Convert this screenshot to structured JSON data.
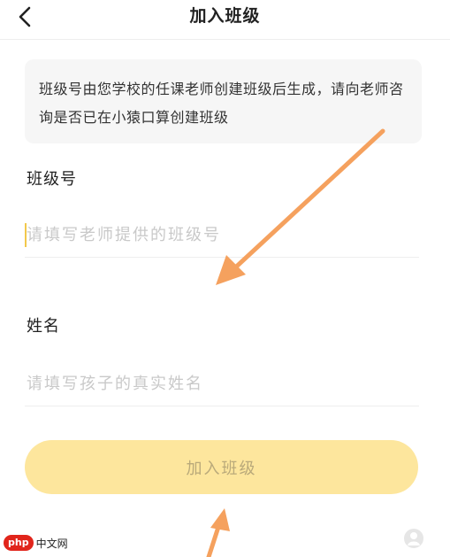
{
  "header": {
    "title": "加入班级",
    "back_icon": "chevron-left-icon"
  },
  "notice": {
    "text": "班级号由您学校的任课老师创建班级后生成，请向老师咨询是否已在小猿口算创建班级"
  },
  "class_number": {
    "label": "班级号",
    "placeholder": "请填写老师提供的班级号",
    "value": ""
  },
  "name": {
    "label": "姓名",
    "placeholder": "请填写孩子的真实姓名",
    "value": ""
  },
  "join_button": {
    "label": "加入班级"
  },
  "watermark": {
    "badge": "php",
    "text": "中文网"
  },
  "colors": {
    "accent": "#fde69d",
    "annotation_arrow": "#f5a15e",
    "caret": "#f2c84b"
  }
}
